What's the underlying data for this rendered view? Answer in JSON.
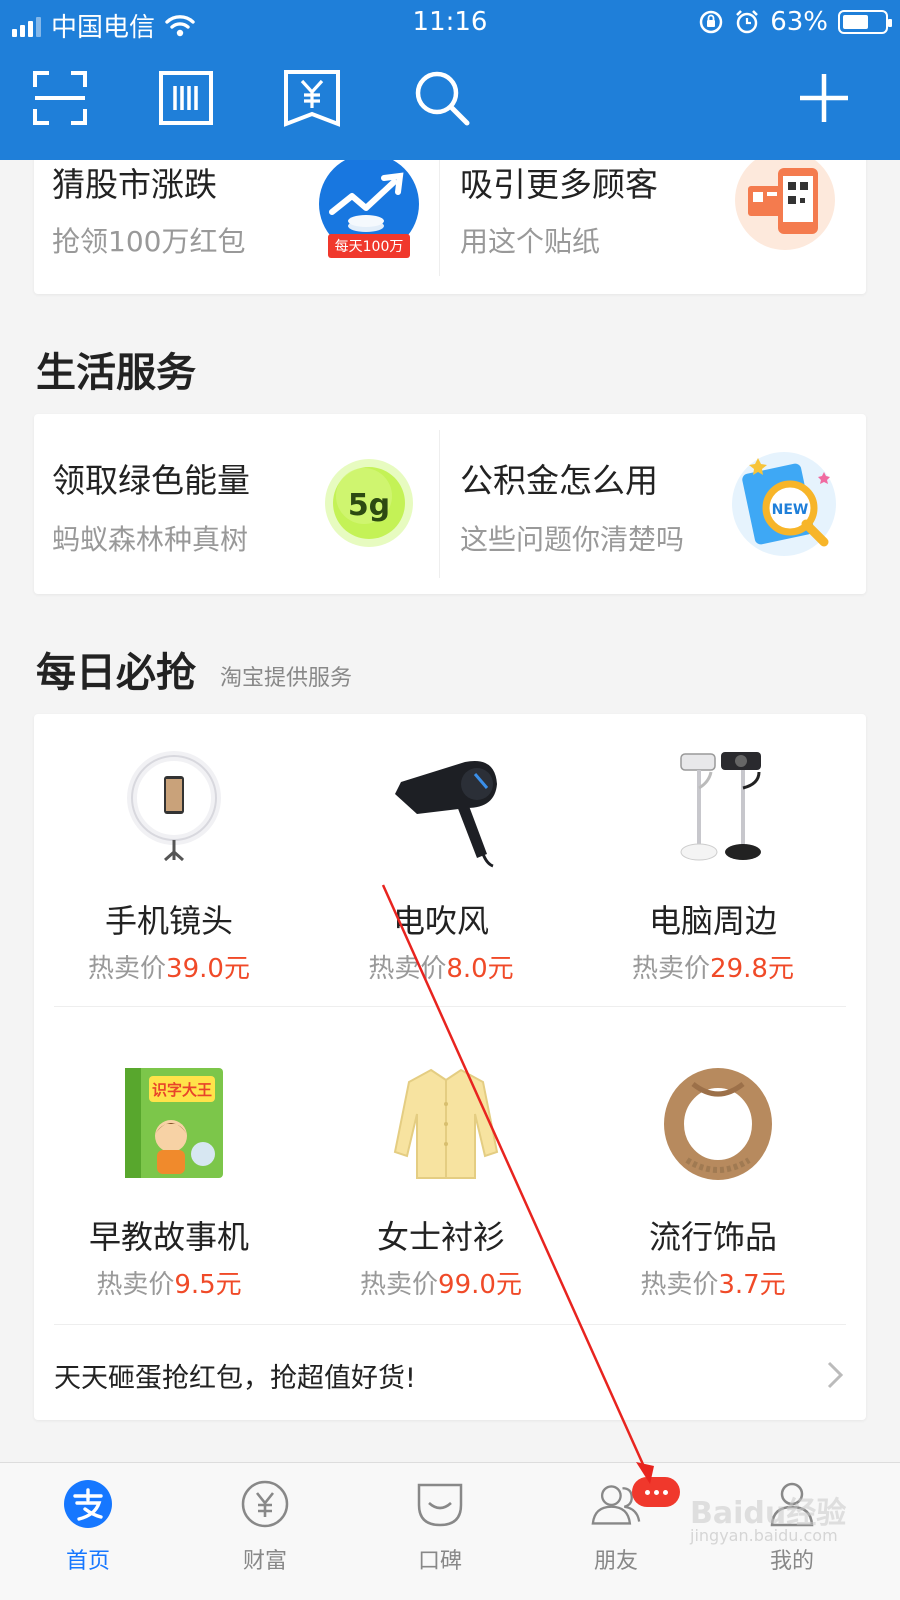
{
  "status_bar": {
    "carrier": "中国电信",
    "time": "11:16",
    "battery_percent": "63%",
    "battery_level": 0.63
  },
  "header": {
    "ghost_title": "",
    "icons": [
      "scan-icon",
      "barcode-icon",
      "payment-code-icon",
      "search-icon",
      "plus-icon"
    ]
  },
  "top_promos": [
    {
      "title": "猜股市涨跌",
      "subtitle": "抢领100万红包",
      "icon_badge": "每天100万"
    },
    {
      "title": "吸引更多顾客",
      "subtitle": "用这个贴纸"
    }
  ],
  "life_services": {
    "title": "生活服务",
    "items": [
      {
        "title": "领取绿色能量",
        "subtitle": "蚂蚁森林种真树",
        "icon_text": "5g"
      },
      {
        "title": "公积金怎么用",
        "subtitle": "这些问题你清楚吗",
        "icon_text": "NEW"
      }
    ]
  },
  "daily_deals": {
    "title": "每日必抢",
    "subtitle": "淘宝提供服务",
    "price_prefix": "热卖价",
    "products": [
      {
        "name": "手机镜头",
        "price": "39.0元",
        "icon": "ring-light-icon"
      },
      {
        "name": "电吹风",
        "price": "8.0元",
        "icon": "hair-dryer-icon"
      },
      {
        "name": "电脑周边",
        "price": "29.8元",
        "icon": "webcam-icon"
      },
      {
        "name": "早教故事机",
        "price": "9.5元",
        "icon": "book-icon",
        "book_title": "识字大王"
      },
      {
        "name": "女士衬衫",
        "price": "99.0元",
        "icon": "shirt-icon"
      },
      {
        "name": "流行饰品",
        "price": "3.7元",
        "icon": "headband-icon"
      }
    ],
    "footer": "天天砸蛋抢红包，抢超值好货!"
  },
  "tabbar": {
    "tabs": [
      {
        "label": "首页",
        "icon": "alipay-icon",
        "active": true
      },
      {
        "label": "财富",
        "icon": "wealth-icon"
      },
      {
        "label": "口碑",
        "icon": "koubei-icon"
      },
      {
        "label": "朋友",
        "icon": "friends-icon"
      },
      {
        "label": "我的",
        "icon": "profile-icon"
      }
    ]
  },
  "watermark": {
    "text": "Baidu经验",
    "sub": "jingyan.baidu.com"
  },
  "colors": {
    "brand_blue": "#1f7fd9",
    "price_red": "#f04a28",
    "active_tab": "#1677ff",
    "badge_red": "#f0382c",
    "annotation_red": "#e8241f"
  }
}
